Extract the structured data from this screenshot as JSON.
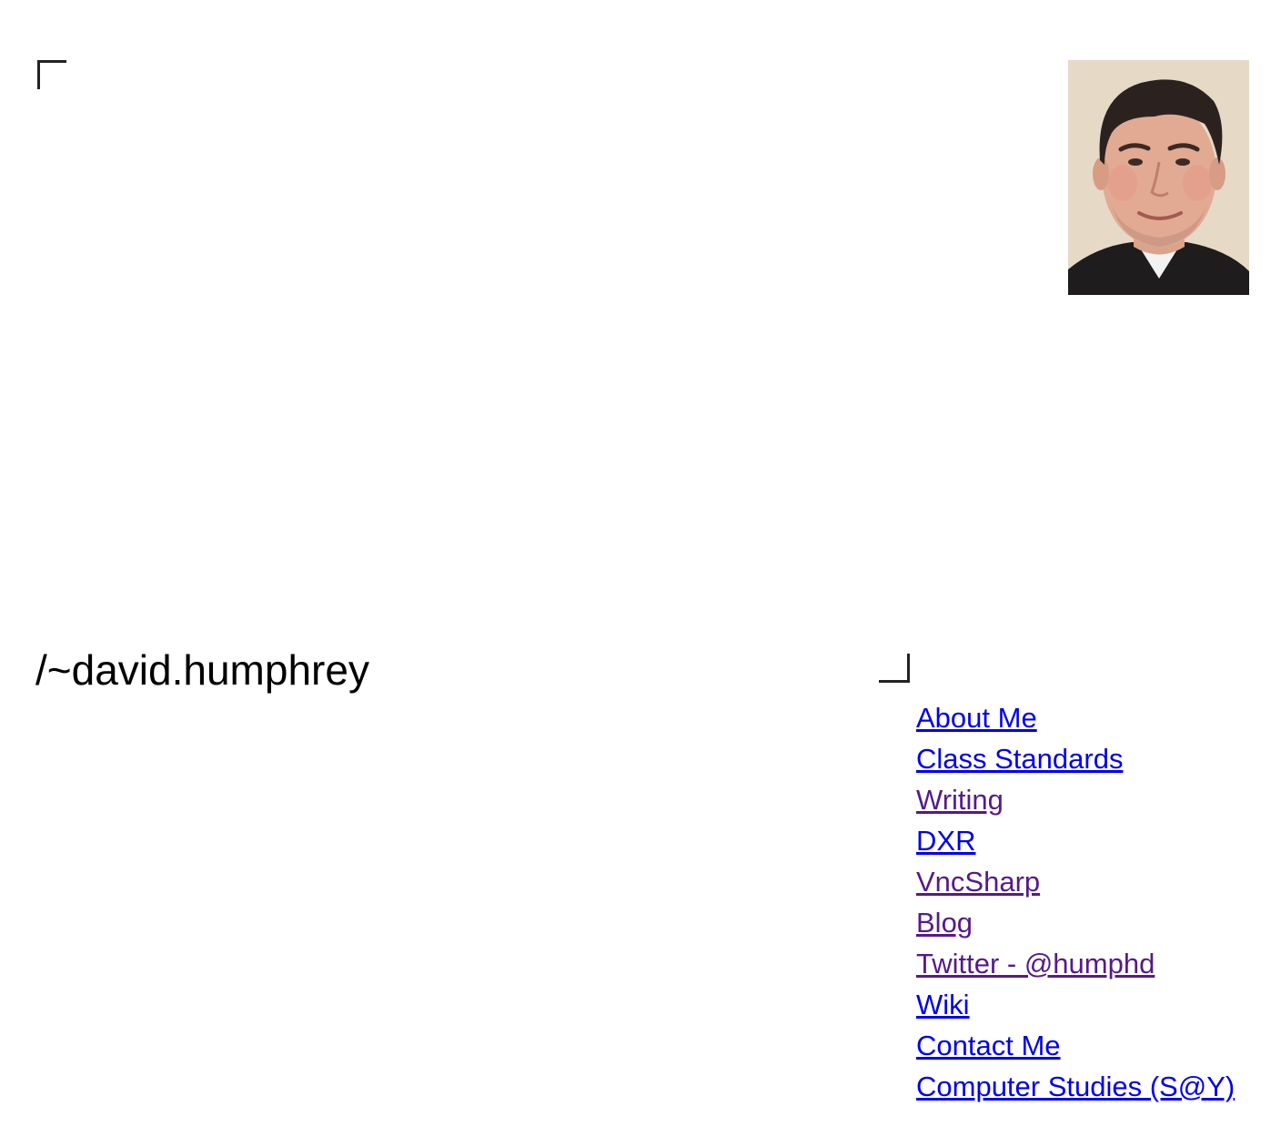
{
  "header": {
    "site_title": "/~david.humphrey"
  },
  "profile": {
    "photo_alt": "David Humphrey"
  },
  "nav": {
    "items": [
      {
        "label": "About Me",
        "visited": false
      },
      {
        "label": "Class Standards",
        "visited": false
      },
      {
        "label": "Writing",
        "visited": true
      },
      {
        "label": "DXR",
        "visited": false
      },
      {
        "label": "VncSharp",
        "visited": true
      },
      {
        "label": "Blog",
        "visited": true
      },
      {
        "label": "Twitter - @humphd",
        "visited": true
      },
      {
        "label": "Wiki",
        "visited": false
      },
      {
        "label": "Contact Me",
        "visited": false
      },
      {
        "label": "Computer Studies (S@Y)",
        "visited": false
      }
    ]
  },
  "colors": {
    "link": "#0000ee",
    "visited_link": "#551a8b",
    "text": "#000000",
    "background": "#ffffff"
  }
}
